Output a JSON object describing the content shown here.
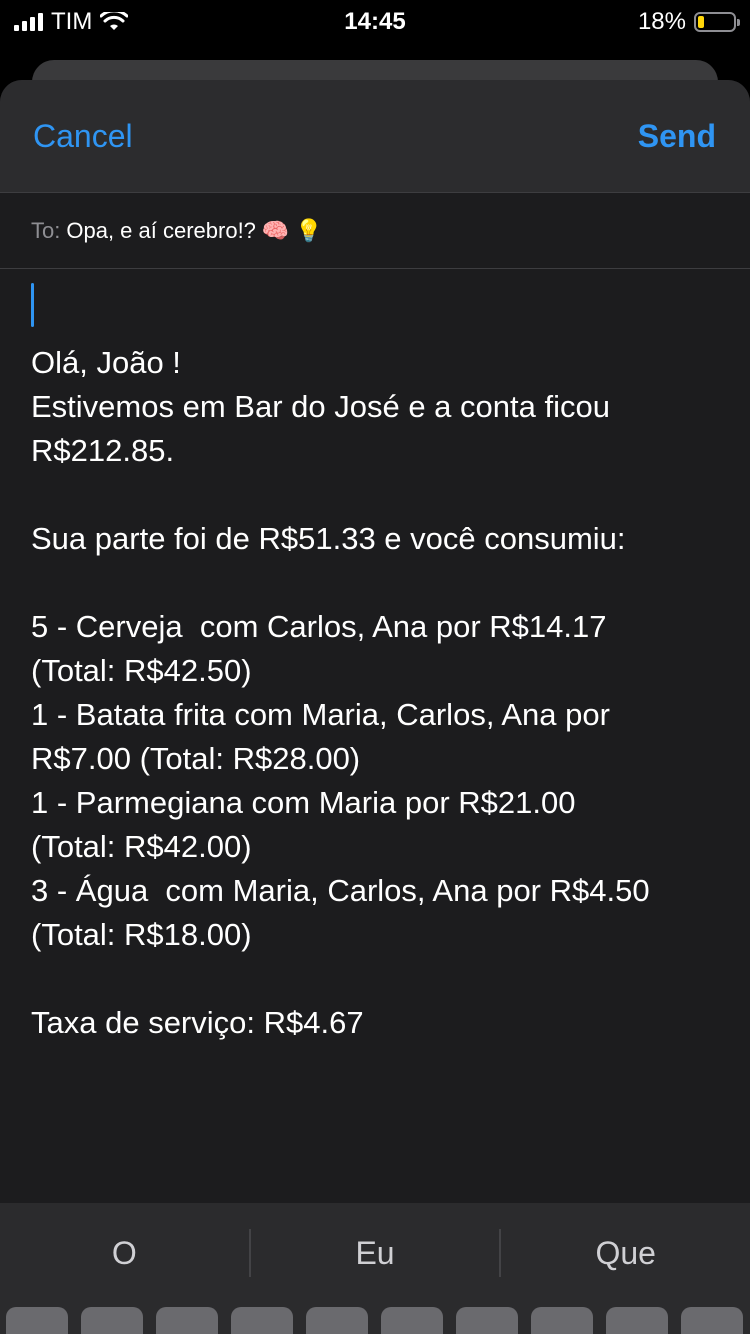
{
  "status_bar": {
    "carrier": "TIM",
    "time": "14:45",
    "battery_percent": "18%",
    "battery_level": 0.18,
    "signal_icon": "cellular-signal-icon",
    "wifi_icon": "wifi-icon",
    "battery_icon": "battery-icon",
    "battery_color": "#ffd60a"
  },
  "compose": {
    "cancel_label": "Cancel",
    "send_label": "Send",
    "accent_color": "#2f95f3",
    "to_label": "To:",
    "to_value": "Opa, e aí cerebro!?",
    "to_emojis": [
      "🧠",
      "💡"
    ],
    "body_lines": [
      "Olá, João !",
      "Estivemos em Bar do José e a conta ficou",
      "R$212.85.",
      "",
      "Sua parte foi de R$51.33 e você consumiu:",
      "",
      "5 - Cerveja  com Carlos, Ana por R$14.17",
      "(Total: R$42.50)",
      "1 - Batata frita com Maria, Carlos, Ana por",
      "R$7.00 (Total: R$28.00)",
      "1 - Parmegiana com Maria por R$21.00",
      "(Total: R$42.00)",
      "3 - Água  com Maria, Carlos, Ana por R$4.50",
      "(Total: R$18.00)",
      "",
      "Taxa de serviço: R$4.67"
    ]
  },
  "keyboard": {
    "suggestions": [
      "O",
      "Eu",
      "Que"
    ]
  }
}
